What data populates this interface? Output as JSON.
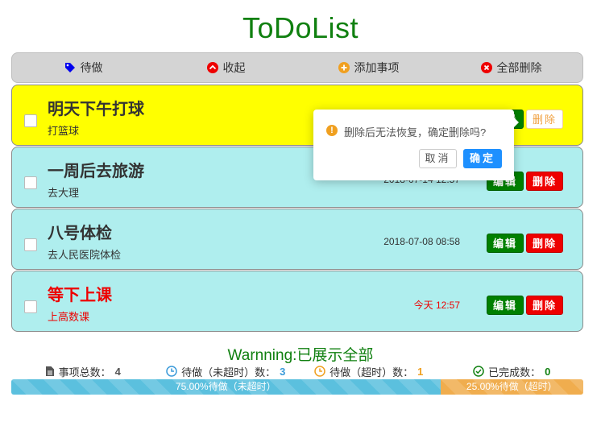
{
  "app": {
    "title": "ToDoList"
  },
  "toolbar": {
    "items": [
      {
        "label": "待做",
        "icon": "tag-icon",
        "color": "#0000ee"
      },
      {
        "label": "收起",
        "icon": "chevron-up-icon",
        "color": "#ee0000"
      },
      {
        "label": "添加事项",
        "icon": "plus-icon",
        "color": "#f0a020"
      },
      {
        "label": "全部删除",
        "icon": "close-icon",
        "color": "#ee0000"
      }
    ]
  },
  "todos": [
    {
      "title": "明天下午打球",
      "desc": "打篮球",
      "time": "",
      "style": "yellow",
      "edit": "编辑",
      "delete": "删除"
    },
    {
      "title": "一周后去旅游",
      "desc": "去大理",
      "time": "2018-07-14 12:57",
      "style": "cyan",
      "edit": "编辑",
      "delete": "删除"
    },
    {
      "title": "八号体检",
      "desc": "去人民医院体检",
      "time": "2018-07-08 08:58",
      "style": "cyan",
      "edit": "编辑",
      "delete": "删除"
    },
    {
      "title": "等下上课",
      "desc": "上高数课",
      "time": "今天 12:57",
      "style": "cyan-red",
      "edit": "编辑",
      "delete": "删除"
    }
  ],
  "popover": {
    "message": "删除后无法恢复，确定删除吗?",
    "cancel": "取消",
    "confirm": "确定"
  },
  "warning": "Warnning:已展示全部",
  "stats": {
    "total_label": "事项总数：",
    "total": "4",
    "pending_label": "待做（未超时）数：",
    "pending": "3",
    "overdue_label": "待做（超时）数：",
    "overdue": "1",
    "done_label": "已完成数：",
    "done": "0"
  },
  "progress": {
    "pending_fraction": 0.75,
    "pending_label": "75.00%待做（未超时）",
    "overdue_fraction": 0.25,
    "overdue_label": "25.00%待做（超时）"
  },
  "colors": {
    "title_green": "#108010",
    "yellow": "#ffff00",
    "cyan": "#afeeee",
    "edit_green": "#008000",
    "delete_red": "#ee0000",
    "progress_blue": "#5bc0de",
    "progress_orange": "#f0ad4e"
  }
}
